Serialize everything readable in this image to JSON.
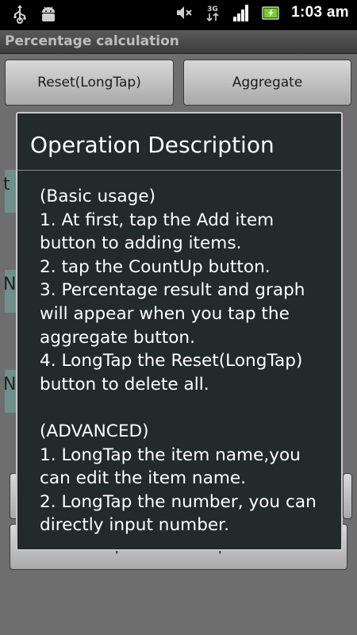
{
  "status_bar": {
    "time": "1:03 am",
    "network_label": "3G",
    "left_icons": [
      "usb-icon",
      "android-debug-icon"
    ],
    "right_icons": [
      "volume-muted-icon",
      "network-3g-icon",
      "signal-bars-icon",
      "battery-charging-icon"
    ]
  },
  "app": {
    "title": "Percentage calculation",
    "buttons": {
      "reset": "Reset(LongTap)",
      "aggregate": "Aggregate",
      "operation_description": "Operation Description"
    },
    "rows": [
      {
        "partial_label": "t"
      },
      {
        "partial_label": "N"
      },
      {
        "partial_label": "N"
      }
    ]
  },
  "dialog": {
    "title": "Operation Description",
    "body": "(Basic usage)\n1. At first, tap the Add item button to adding items.\n2. tap the CountUp button.\n3. Percentage result and graph will appear when you tap the aggregate button.\n4. LongTap the Reset(LongTap) button to delete all.\n\n(ADVANCED)\n1. LongTap the item name,you can edit the item name.\n2. LongTap the number, you can directly input number."
  },
  "colors": {
    "dialog_bg": "#222a2b",
    "dialog_border": "#c9c9c9",
    "dim_bg": "#6e6e6e",
    "row_accent": "#6f8f8a"
  }
}
